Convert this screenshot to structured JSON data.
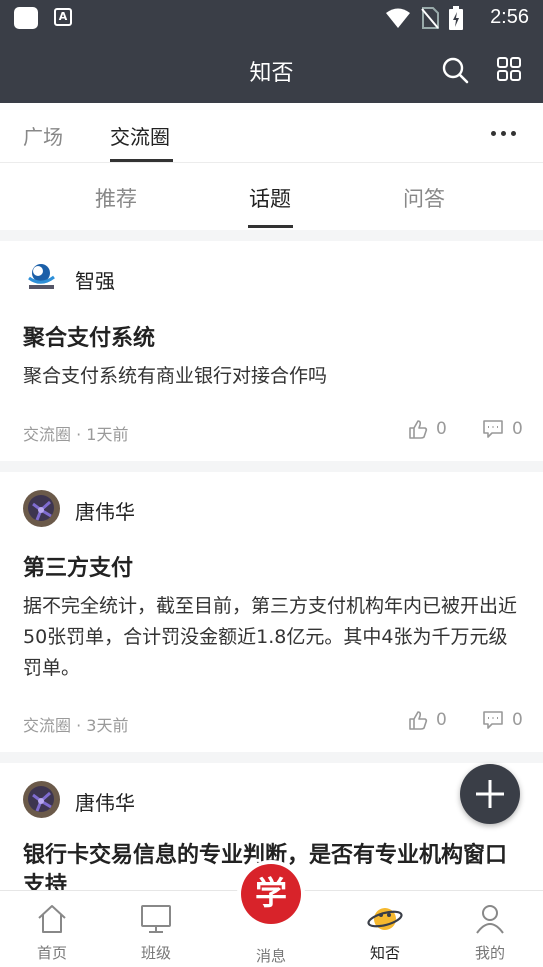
{
  "status_bar": {
    "time": "2:56"
  },
  "header": {
    "title": "知否"
  },
  "tabs_primary": [
    {
      "label": "广场"
    },
    {
      "label": "交流圈"
    }
  ],
  "tabs_secondary": [
    {
      "label": "推荐"
    },
    {
      "label": "话题"
    },
    {
      "label": "问答"
    }
  ],
  "posts": [
    {
      "author": "智强",
      "title": "聚合支付系统",
      "body": "聚合支付系统有商业银行对接合作吗",
      "meta": "交流圈 · 1天前",
      "likes": "0",
      "comments": "0"
    },
    {
      "author": "唐伟华",
      "title": "第三方支付",
      "body": "据不完全统计，截至目前，第三方支付机构年内已被开出近50张罚单，合计罚没金额近1.8亿元。其中4张为千万元级罚单。",
      "meta": "交流圈 · 3天前",
      "likes": "0",
      "comments": "0"
    },
    {
      "author": "唐伟华",
      "title": "银行卡交易信息的专业判断，是否有专业机构窗口支持"
    }
  ],
  "bottom_nav": [
    {
      "label": "首页"
    },
    {
      "label": "班级"
    },
    {
      "label": "消息",
      "badge_text": "学"
    },
    {
      "label": "知否"
    },
    {
      "label": "我的"
    }
  ],
  "colors": {
    "header_bg": "#3a3e47",
    "accent_red": "#d8232a"
  }
}
